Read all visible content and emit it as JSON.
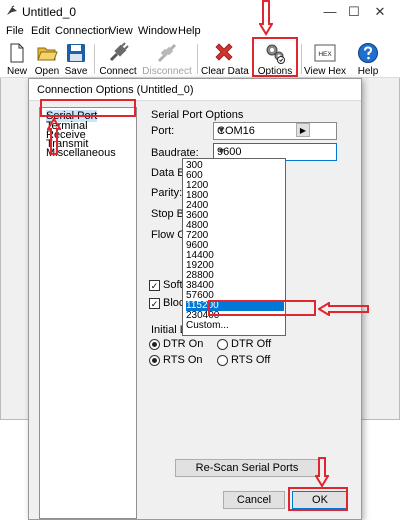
{
  "window": {
    "title": "Untitled_0",
    "minimize_glyph": "—",
    "maximize_glyph": "☐",
    "close_glyph": "✕"
  },
  "menu": [
    "File",
    "Edit",
    "Connection",
    "View",
    "Window",
    "Help"
  ],
  "toolbar": {
    "new": "New",
    "open": "Open",
    "save": "Save",
    "connect": "Connect",
    "disconnect": "Disconnect",
    "clear_data": "Clear Data",
    "options": "Options",
    "view_hex": "View Hex",
    "help": "Help",
    "hex_icon_text": "HEX"
  },
  "dialog": {
    "title": "Connection Options (Untitled_0)",
    "categories": [
      "Serial Port",
      "Terminal",
      "Receive",
      "Transmit",
      "Miscellaneous"
    ],
    "section_title": "Serial Port Options",
    "port_label": "Port:",
    "port_value": "COM16",
    "port_more_glyph": "▶",
    "baudrate_label": "Baudrate:",
    "baudrate_value": "9600",
    "data_bits_label": "Data Bits:",
    "parity_label": "Parity:",
    "stop_bits_label": "Stop Bits:",
    "flow_control_label": "Flow Control:",
    "baud_options": [
      "300",
      "600",
      "1200",
      "1800",
      "2400",
      "3600",
      "4800",
      "7200",
      "9600",
      "14400",
      "19200",
      "28800",
      "38400",
      "57600",
      "115200",
      "230400",
      "Custom..."
    ],
    "baud_selected_index": 14,
    "software_supp_label": "Software Supp",
    "block_keystrokes_label": "Block Keystro",
    "initial_line_states_label": "Initial Line States",
    "dtr_on": "DTR On",
    "dtr_off": "DTR Off",
    "rts_on": "RTS On",
    "rts_off": "RTS Off",
    "rescan_button": "Re-Scan Serial Ports",
    "cancel_button": "Cancel",
    "ok_button": "OK",
    "check_glyph": "✓"
  },
  "colors": {
    "highlight": "#e0262e",
    "selection": "#0078d7"
  }
}
